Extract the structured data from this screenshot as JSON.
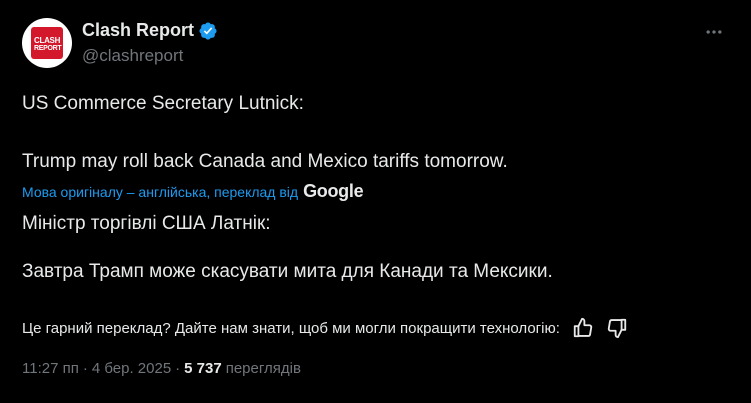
{
  "author": {
    "display_name": "Clash Report",
    "handle": "@clashreport",
    "avatar_text_line1": "CLASH",
    "avatar_text_line2": "REPORT",
    "verified": true,
    "brand_color": "#d3182b",
    "verified_color": "#1d9bf0"
  },
  "menu": {
    "more_icon": "more-horizontal-icon"
  },
  "post": {
    "original_line1": "US Commerce Secretary Lutnick:",
    "original_line2": "Trump may roll back Canada and Mexico tariffs tomorrow."
  },
  "translation": {
    "note_link": "Мова оригіналу – англійська, переклад від",
    "provider": "Google",
    "line1": "Міністр торгівлі США Латнік:",
    "line2": "Завтра Трамп може скасувати мита для Канади та Мексики."
  },
  "feedback": {
    "question": "Це гарний переклад? Дайте нам знати, щоб ми могли покращити технологію:",
    "like_icon": "thumbs-up-icon",
    "dislike_icon": "thumbs-down-icon"
  },
  "meta": {
    "time": "11:27 пп",
    "separator": "·",
    "date": "4 бер. 2025",
    "views_count": "5 737",
    "views_label": "переглядів"
  }
}
